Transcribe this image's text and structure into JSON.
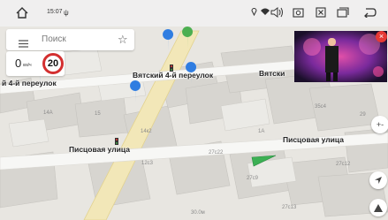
{
  "status_bar": {
    "time": "15:07",
    "icons": [
      "home-icon",
      "usb-icon",
      "location-icon",
      "wifi-icon",
      "volume-icon",
      "camera-icon",
      "close-box-icon",
      "recent-apps-icon",
      "back-icon"
    ]
  },
  "search": {
    "placeholder": "Поиск"
  },
  "speed": {
    "value": "0",
    "unit": "км/ч",
    "limit": "20"
  },
  "streets": {
    "pereulok_left": "й 4-й переулок",
    "pereulok_center": "Вятский 4-й переулок",
    "vyatsky_right": "Вятски",
    "pistsovaya_left": "Писцовая улица",
    "pistsovaya_right": "Писцовая улица"
  },
  "building_numbers": {
    "n14a": "14A",
    "n15": "15",
    "n14k2": "14к2",
    "n12c3": "12с3",
    "n27c22": "27с22",
    "n1a": "1А",
    "n35c4": "35с4",
    "n29": "29",
    "n27c12": "27с12",
    "n27c9": "27с9",
    "n27c13": "27с13",
    "scale": "30.0м"
  },
  "map_buttons": {
    "zoom_plus": "+",
    "zoom_minus": "-",
    "warning": "!"
  },
  "colors": {
    "accent_red": "#d32f2f",
    "nav_arrow": "#3cb054",
    "status_bar_bg": "#f0f0f0"
  }
}
